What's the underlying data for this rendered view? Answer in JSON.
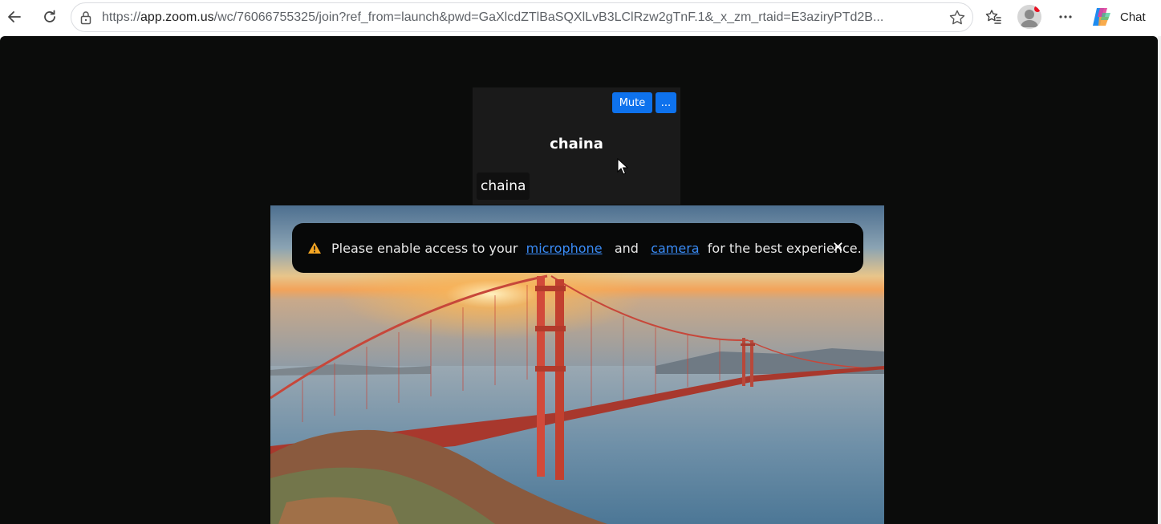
{
  "browser": {
    "url_prefix": "https://",
    "url_host": "app.zoom.us",
    "url_path": "/wc/76066755325/join?ref_from=launch&pwd=GaXlcdZTlBaSQXlLvB3LClRzw2gTnF.1&_x_zm_rtaid=E3aziryPTd2B...",
    "chat_label": "Chat",
    "icons": [
      "back-icon",
      "refresh-icon",
      "lock-icon",
      "star-icon",
      "favorites-icon",
      "profile-avatar",
      "more-icon",
      "copilot-icon"
    ]
  },
  "participant_tile": {
    "mute_label": "Mute",
    "more_label": "...",
    "display_name": "chaina",
    "name_tag": "chaina"
  },
  "notice": {
    "text_before": "Please enable access to your",
    "link_microphone": "microphone",
    "text_and": "and",
    "link_camera": "camera",
    "text_after": "for the best experience.",
    "close_label": "✕",
    "warning_color": "#f5a623"
  },
  "colors": {
    "zoom_blue": "#0e72ed",
    "meeting_bg": "#0b0c0b",
    "link": "#3a8cf7"
  }
}
